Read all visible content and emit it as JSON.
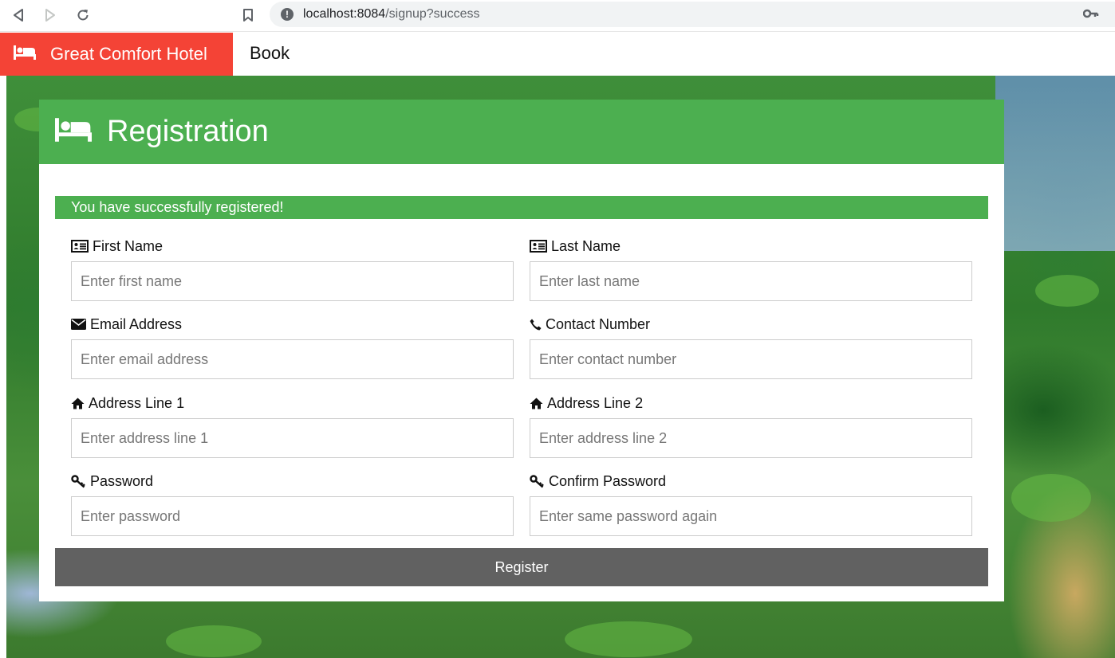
{
  "browser": {
    "url_host": "localhost:8084",
    "url_path": "/signup?success"
  },
  "navbar": {
    "brand": "Great Comfort Hotel",
    "book": "Book"
  },
  "card": {
    "title": "Registration",
    "alert": "You have successfully registered!",
    "fields": {
      "first_name": {
        "label": "First Name",
        "placeholder": "Enter first name"
      },
      "last_name": {
        "label": "Last Name",
        "placeholder": "Enter last name"
      },
      "email": {
        "label": "Email Address",
        "placeholder": "Enter email address"
      },
      "contact": {
        "label": "Contact Number",
        "placeholder": "Enter contact number"
      },
      "address1": {
        "label": "Address Line 1",
        "placeholder": "Enter address line 1"
      },
      "address2": {
        "label": "Address Line 2",
        "placeholder": "Enter address line 2"
      },
      "password": {
        "label": "Password",
        "placeholder": "Enter password"
      },
      "confirm_password": {
        "label": "Confirm Password",
        "placeholder": "Enter same password again"
      }
    },
    "register_label": "Register"
  },
  "colors": {
    "brand_red": "#f44336",
    "header_green": "#4caf50",
    "button_gray": "#616161"
  },
  "icons": {
    "brand": "bed-icon",
    "header": "bed-icon",
    "first_name": "id-card-icon",
    "last_name": "id-card-icon",
    "email": "envelope-icon",
    "contact": "phone-icon",
    "address1": "home-icon",
    "address2": "home-icon",
    "password": "key-icon",
    "confirm_password": "key-icon"
  }
}
